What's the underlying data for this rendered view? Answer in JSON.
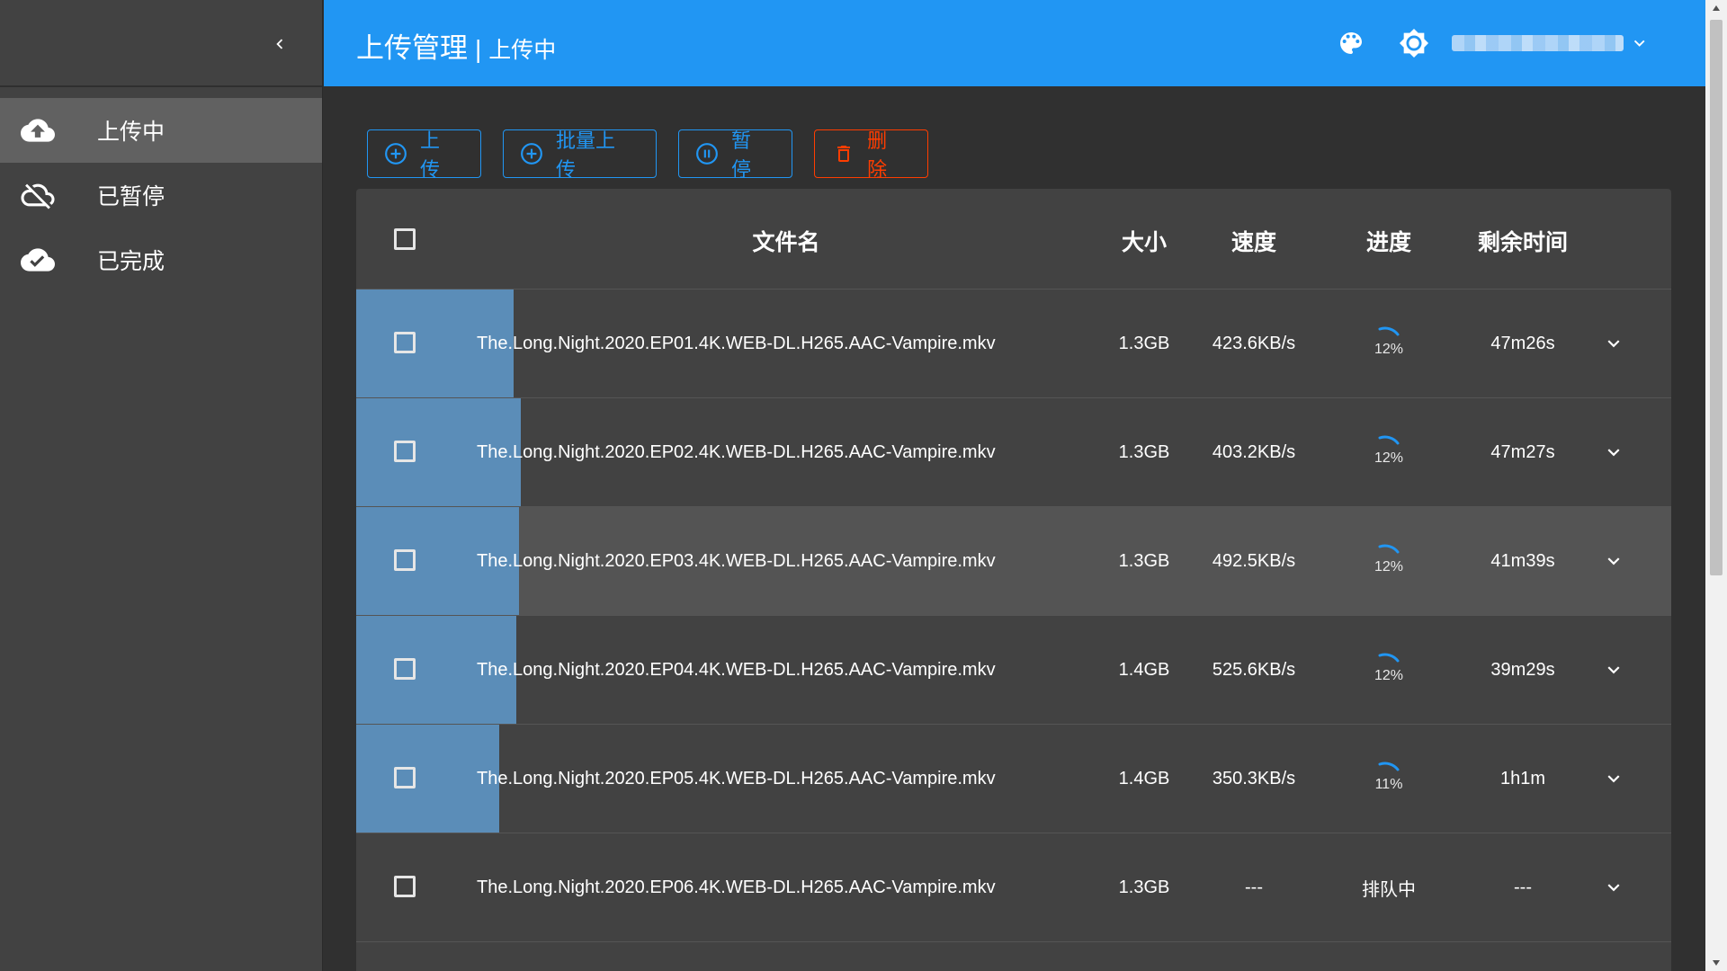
{
  "colors": {
    "primary": "#2196f3",
    "danger": "#ff3d00",
    "progress_fill": "#5b8db8",
    "sidebar_bg": "#424242",
    "content_bg": "#303030"
  },
  "sidebar": {
    "collapse_icon": "chevron-left-icon",
    "items": [
      {
        "label": "上传中",
        "icon": "cloud-upload-icon",
        "active": true
      },
      {
        "label": "已暂停",
        "icon": "cloud-off-icon",
        "active": false
      },
      {
        "label": "已完成",
        "icon": "cloud-check-icon",
        "active": false
      }
    ]
  },
  "header": {
    "title": "上传管理",
    "separator": "|",
    "subtitle": "上传中",
    "icons": [
      "palette-icon",
      "brightness-icon",
      "chevron-down-icon"
    ]
  },
  "toolbar": {
    "upload": "上传",
    "batch_upload": "批量上传",
    "pause": "暂停",
    "delete": "删除"
  },
  "table": {
    "columns": {
      "name": "文件名",
      "size": "大小",
      "speed": "速度",
      "progress": "进度",
      "remaining": "剩余时间"
    },
    "rows": [
      {
        "name": "The.Long.Night.2020.EP01.4K.WEB-DL.H265.AAC-Vampire.mkv",
        "size": "1.3GB",
        "speed": "423.6KB/s",
        "progress": "12%",
        "progress_value": 0.12,
        "remaining": "47m26s"
      },
      {
        "name": "The.Long.Night.2020.EP02.4K.WEB-DL.H265.AAC-Vampire.mkv",
        "size": "1.3GB",
        "speed": "403.2KB/s",
        "progress": "12%",
        "progress_value": 0.125,
        "remaining": "47m27s"
      },
      {
        "name": "The.Long.Night.2020.EP03.4K.WEB-DL.H265.AAC-Vampire.mkv",
        "size": "1.3GB",
        "speed": "492.5KB/s",
        "progress": "12%",
        "progress_value": 0.124,
        "remaining": "41m39s"
      },
      {
        "name": "The.Long.Night.2020.EP04.4K.WEB-DL.H265.AAC-Vampire.mkv",
        "size": "1.4GB",
        "speed": "525.6KB/s",
        "progress": "12%",
        "progress_value": 0.122,
        "remaining": "39m29s"
      },
      {
        "name": "The.Long.Night.2020.EP05.4K.WEB-DL.H265.AAC-Vampire.mkv",
        "size": "1.4GB",
        "speed": "350.3KB/s",
        "progress": "11%",
        "progress_value": 0.109,
        "remaining": "1h1m"
      },
      {
        "name": "The.Long.Night.2020.EP06.4K.WEB-DL.H265.AAC-Vampire.mkv",
        "size": "1.3GB",
        "speed": "---",
        "progress": "排队中",
        "progress_value": 0,
        "remaining": "---"
      }
    ]
  }
}
